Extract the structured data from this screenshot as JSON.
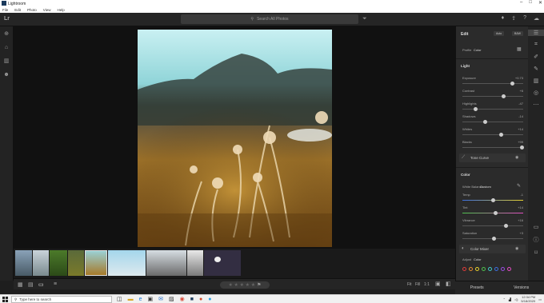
{
  "app": {
    "title": "Lightroom"
  },
  "menu": [
    "File",
    "Edit",
    "Photo",
    "View",
    "Help"
  ],
  "topbar": {
    "logo": "Lr",
    "search_placeholder": "Search All Photos"
  },
  "filmstrip": {
    "rating_stars": "★ ★ ★ ★ ★"
  },
  "edit_panel": {
    "title": "Edit",
    "auto_label": "Auto",
    "bw_label": "B&W",
    "profile_label": "Profile",
    "profile_value": "Color",
    "light": {
      "title": "Light",
      "sliders": [
        {
          "label": "Exposure",
          "value": "+0.73",
          "pos": 0.82
        },
        {
          "label": "Contrast",
          "value": "+6",
          "pos": 0.68
        },
        {
          "label": "Highlights",
          "value": "-47",
          "pos": 0.22
        },
        {
          "label": "Shadows",
          "value": "-14",
          "pos": 0.38
        },
        {
          "label": "Whites",
          "value": "+14",
          "pos": 0.64
        },
        {
          "label": "Blacks",
          "value": "+99",
          "pos": 0.98
        }
      ],
      "tone_curve": "Tone Curve"
    },
    "color": {
      "title": "Color",
      "white_balance_label": "White Balance",
      "white_balance_value": "Custom",
      "sliders": [
        {
          "label": "Temp",
          "value": "-1",
          "pos": 0.5
        },
        {
          "label": "Tint",
          "value": "+14",
          "pos": 0.55
        },
        {
          "label": "Vibrance",
          "value": "+16",
          "pos": 0.72
        },
        {
          "label": "Saturation",
          "value": "+3",
          "pos": 0.52
        }
      ],
      "color_mixer": "Color Mixer",
      "adjust_label": "Adjust",
      "adjust_value": "Color",
      "swatch_colors": [
        "#e23b3b",
        "#e68a2e",
        "#e6d12e",
        "#4ec24e",
        "#3fc6c6",
        "#3b6fe2",
        "#9a4ee2",
        "#e24ec2"
      ]
    },
    "footer": {
      "presets": "Presets",
      "versions": "Versions"
    }
  },
  "bottombar": {
    "fit": "Fit",
    "fill": "Fill",
    "ratio": "1:1"
  },
  "taskbar": {
    "search_placeholder": "Type here to search",
    "time": "12:34 PM",
    "date": "5/18/2020"
  }
}
